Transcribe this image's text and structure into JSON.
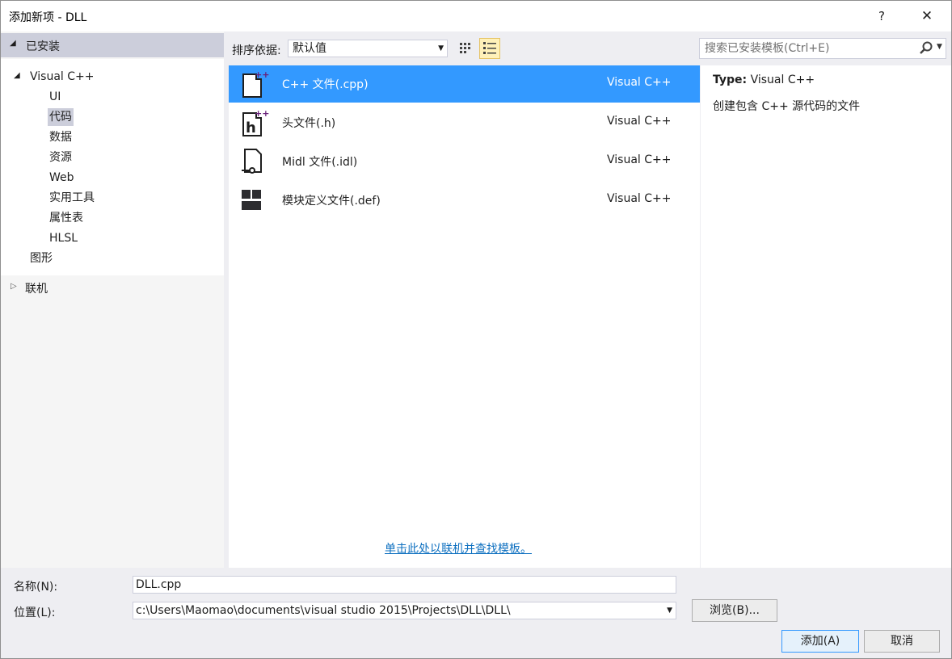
{
  "window": {
    "title": "添加新项 - DLL",
    "help_glyph": "?",
    "close_glyph": "✕"
  },
  "sidebar": {
    "installed_label": "已安装",
    "tree": {
      "root": "Visual C++",
      "children": [
        "UI",
        "代码",
        "数据",
        "资源",
        "Web",
        "实用工具",
        "属性表",
        "HLSL"
      ],
      "selected": "代码",
      "sibling": "图形"
    },
    "online_label": "联机"
  },
  "toolbar": {
    "sort_label": "排序依据:",
    "sort_value": "默认值",
    "search_placeholder": "搜索已安装模板(Ctrl+E)"
  },
  "templates": [
    {
      "name": "C++ 文件(.cpp)",
      "language": "Visual C++",
      "icon": "cpp-file-icon",
      "selected": true
    },
    {
      "name": "头文件(.h)",
      "language": "Visual C++",
      "icon": "header-file-icon",
      "selected": false
    },
    {
      "name": "Midl 文件(.idl)",
      "language": "Visual C++",
      "icon": "idl-file-icon",
      "selected": false
    },
    {
      "name": "模块定义文件(.def)",
      "language": "Visual C++",
      "icon": "def-file-icon",
      "selected": false
    }
  ],
  "online_link": "单击此处以联机并查找模板。",
  "details": {
    "type_label": "Type:",
    "type_value": "Visual C++",
    "description": "创建包含 C++ 源代码的文件"
  },
  "form": {
    "name_label": "名称(N):",
    "name_value": "DLL.cpp",
    "location_label": "位置(L):",
    "location_value": "c:\\Users\\Maomao\\documents\\visual studio 2015\\Projects\\DLL\\DLL\\",
    "browse_label": "浏览(B)...",
    "add_label": "添加(A)",
    "cancel_label": "取消"
  },
  "colors": {
    "selection": "#3399ff",
    "tree_selected": "#cccedb",
    "link": "#0e70c0",
    "accent_purple": "#68217a"
  }
}
